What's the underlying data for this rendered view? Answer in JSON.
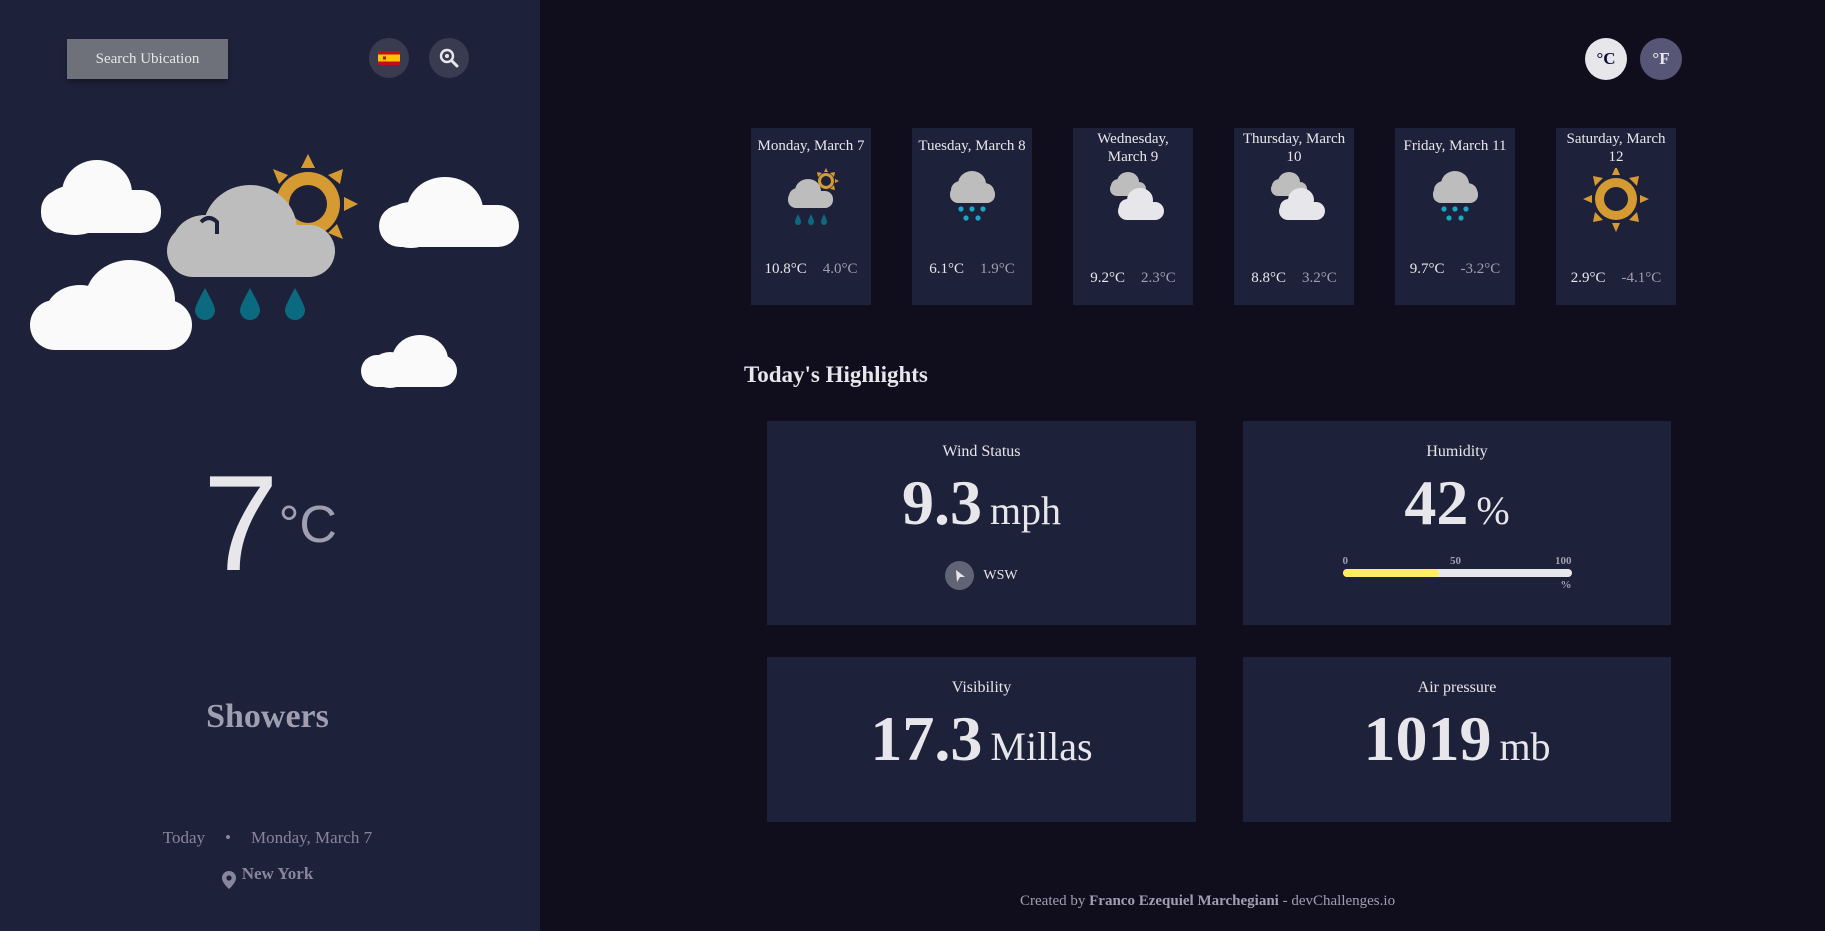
{
  "sidebar": {
    "search_label": "Search Ubication",
    "language_icon": "spain-flag-icon",
    "locate_icon": "location-search-icon",
    "current_temp": "7",
    "current_unit": "°C",
    "condition": "Showers",
    "today_label": "Today",
    "separator": "•",
    "date": "Monday, March 7",
    "location": "New York"
  },
  "units": {
    "celsius": "°C",
    "fahrenheit": "°F",
    "active": "celsius"
  },
  "forecast": [
    {
      "day": "Monday, March 7",
      "icon": "showers-icon",
      "max": "10.8°C",
      "min": "4.0°C"
    },
    {
      "day": "Tuesday, March 8",
      "icon": "sleet-icon",
      "max": "6.1°C",
      "min": "1.9°C"
    },
    {
      "day": "Wednesday, March 9",
      "icon": "heavy-cloud-icon",
      "max": "9.2°C",
      "min": "2.3°C"
    },
    {
      "day": "Thursday, March 10",
      "icon": "heavy-cloud-icon",
      "max": "8.8°C",
      "min": "3.2°C"
    },
    {
      "day": "Friday, March 11",
      "icon": "sleet-icon",
      "max": "9.7°C",
      "min": "-3.2°C"
    },
    {
      "day": "Saturday, March 12",
      "icon": "clear-icon",
      "max": "2.9°C",
      "min": "-4.1°C"
    }
  ],
  "highlights": {
    "title": "Today's Highlights",
    "wind": {
      "label": "Wind Status",
      "value": "9.3",
      "unit": "mph",
      "direction": "WSW"
    },
    "humidity": {
      "label": "Humidity",
      "value": "42",
      "unit": "%",
      "scale": [
        "0",
        "50",
        "100"
      ],
      "scale_unit": "%",
      "fill": 0.42
    },
    "visibility": {
      "label": "Visibility",
      "value": "17.3",
      "unit": "Millas"
    },
    "pressure": {
      "label": "Air pressure",
      "value": "1019",
      "unit": "mb"
    }
  },
  "footer": {
    "prefix": "Created by",
    "author": "Franco Ezequiel Marchegiani",
    "suffix": "- devChallenges.io"
  },
  "colors": {
    "sidebar_bg": "#1e213a",
    "page_bg": "#100e1d",
    "humidity_bar": "#ffec65",
    "sun": "#d69a33",
    "rain_drop": "#0b6a80",
    "snow_dot": "#17a8c4"
  }
}
